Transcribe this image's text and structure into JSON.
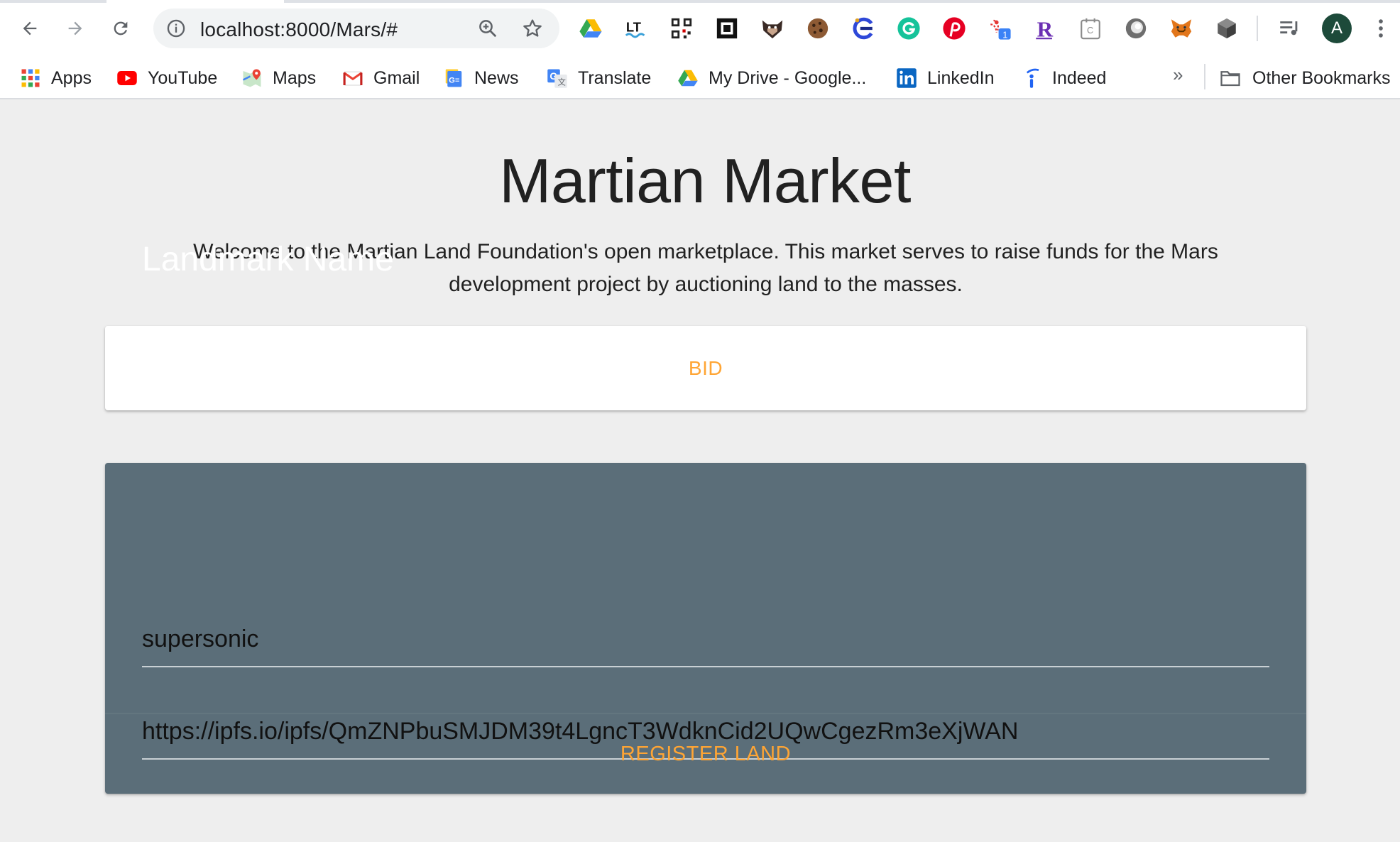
{
  "browser": {
    "url": "localhost:8000/Mars/#",
    "profile_initial": "A",
    "extensions": [
      "google-drive-extension-icon",
      "languagetool-extension-icon",
      "qr-code-extension-icon",
      "square-frame-extension-icon",
      "dog-mask-extension-icon",
      "cookie-extension-icon",
      "clipper-extension-icon",
      "grammarly-extension-icon",
      "pinterest-extension-icon",
      "notification-extension-icon",
      "r-extension-icon",
      "calendar-extension-icon",
      "circle-extension-icon",
      "metamask-extension-icon",
      "cube-extension-icon",
      "playlist-extension-icon"
    ],
    "extension_badge": "1"
  },
  "bookmarks": {
    "items": [
      {
        "label": "Apps",
        "icon": "apps-grid-icon"
      },
      {
        "label": "YouTube",
        "icon": "youtube-icon"
      },
      {
        "label": "Maps",
        "icon": "maps-pin-icon"
      },
      {
        "label": "Gmail",
        "icon": "gmail-icon"
      },
      {
        "label": "News",
        "icon": "news-icon"
      },
      {
        "label": "Translate",
        "icon": "translate-icon"
      },
      {
        "label": "My Drive - Google...",
        "icon": "google-drive-icon"
      },
      {
        "label": "LinkedIn",
        "icon": "linkedin-icon"
      },
      {
        "label": "Indeed",
        "icon": "indeed-icon"
      }
    ],
    "overflow": "»",
    "other_label": "Other Bookmarks"
  },
  "page": {
    "title": "Martian Market",
    "intro": "Welcome to the Martian Land Foundation's open marketplace. This market serves to raise funds for the Mars development project by auctioning land to the masses.",
    "overlay_label": "Landmark Name",
    "bid_label": "BID",
    "register": {
      "name_value": "supersonic",
      "url_value": "https://ipfs.io/ipfs/QmZNPbuSMJDM39t4LgncT3WdknCid2UQwCgezRm3eXjWAN",
      "button_label": "REGISTER LAND"
    }
  },
  "colors": {
    "accent": "#ffa534",
    "register_card": "#5b6e79",
    "page_background": "#eeeeee"
  }
}
